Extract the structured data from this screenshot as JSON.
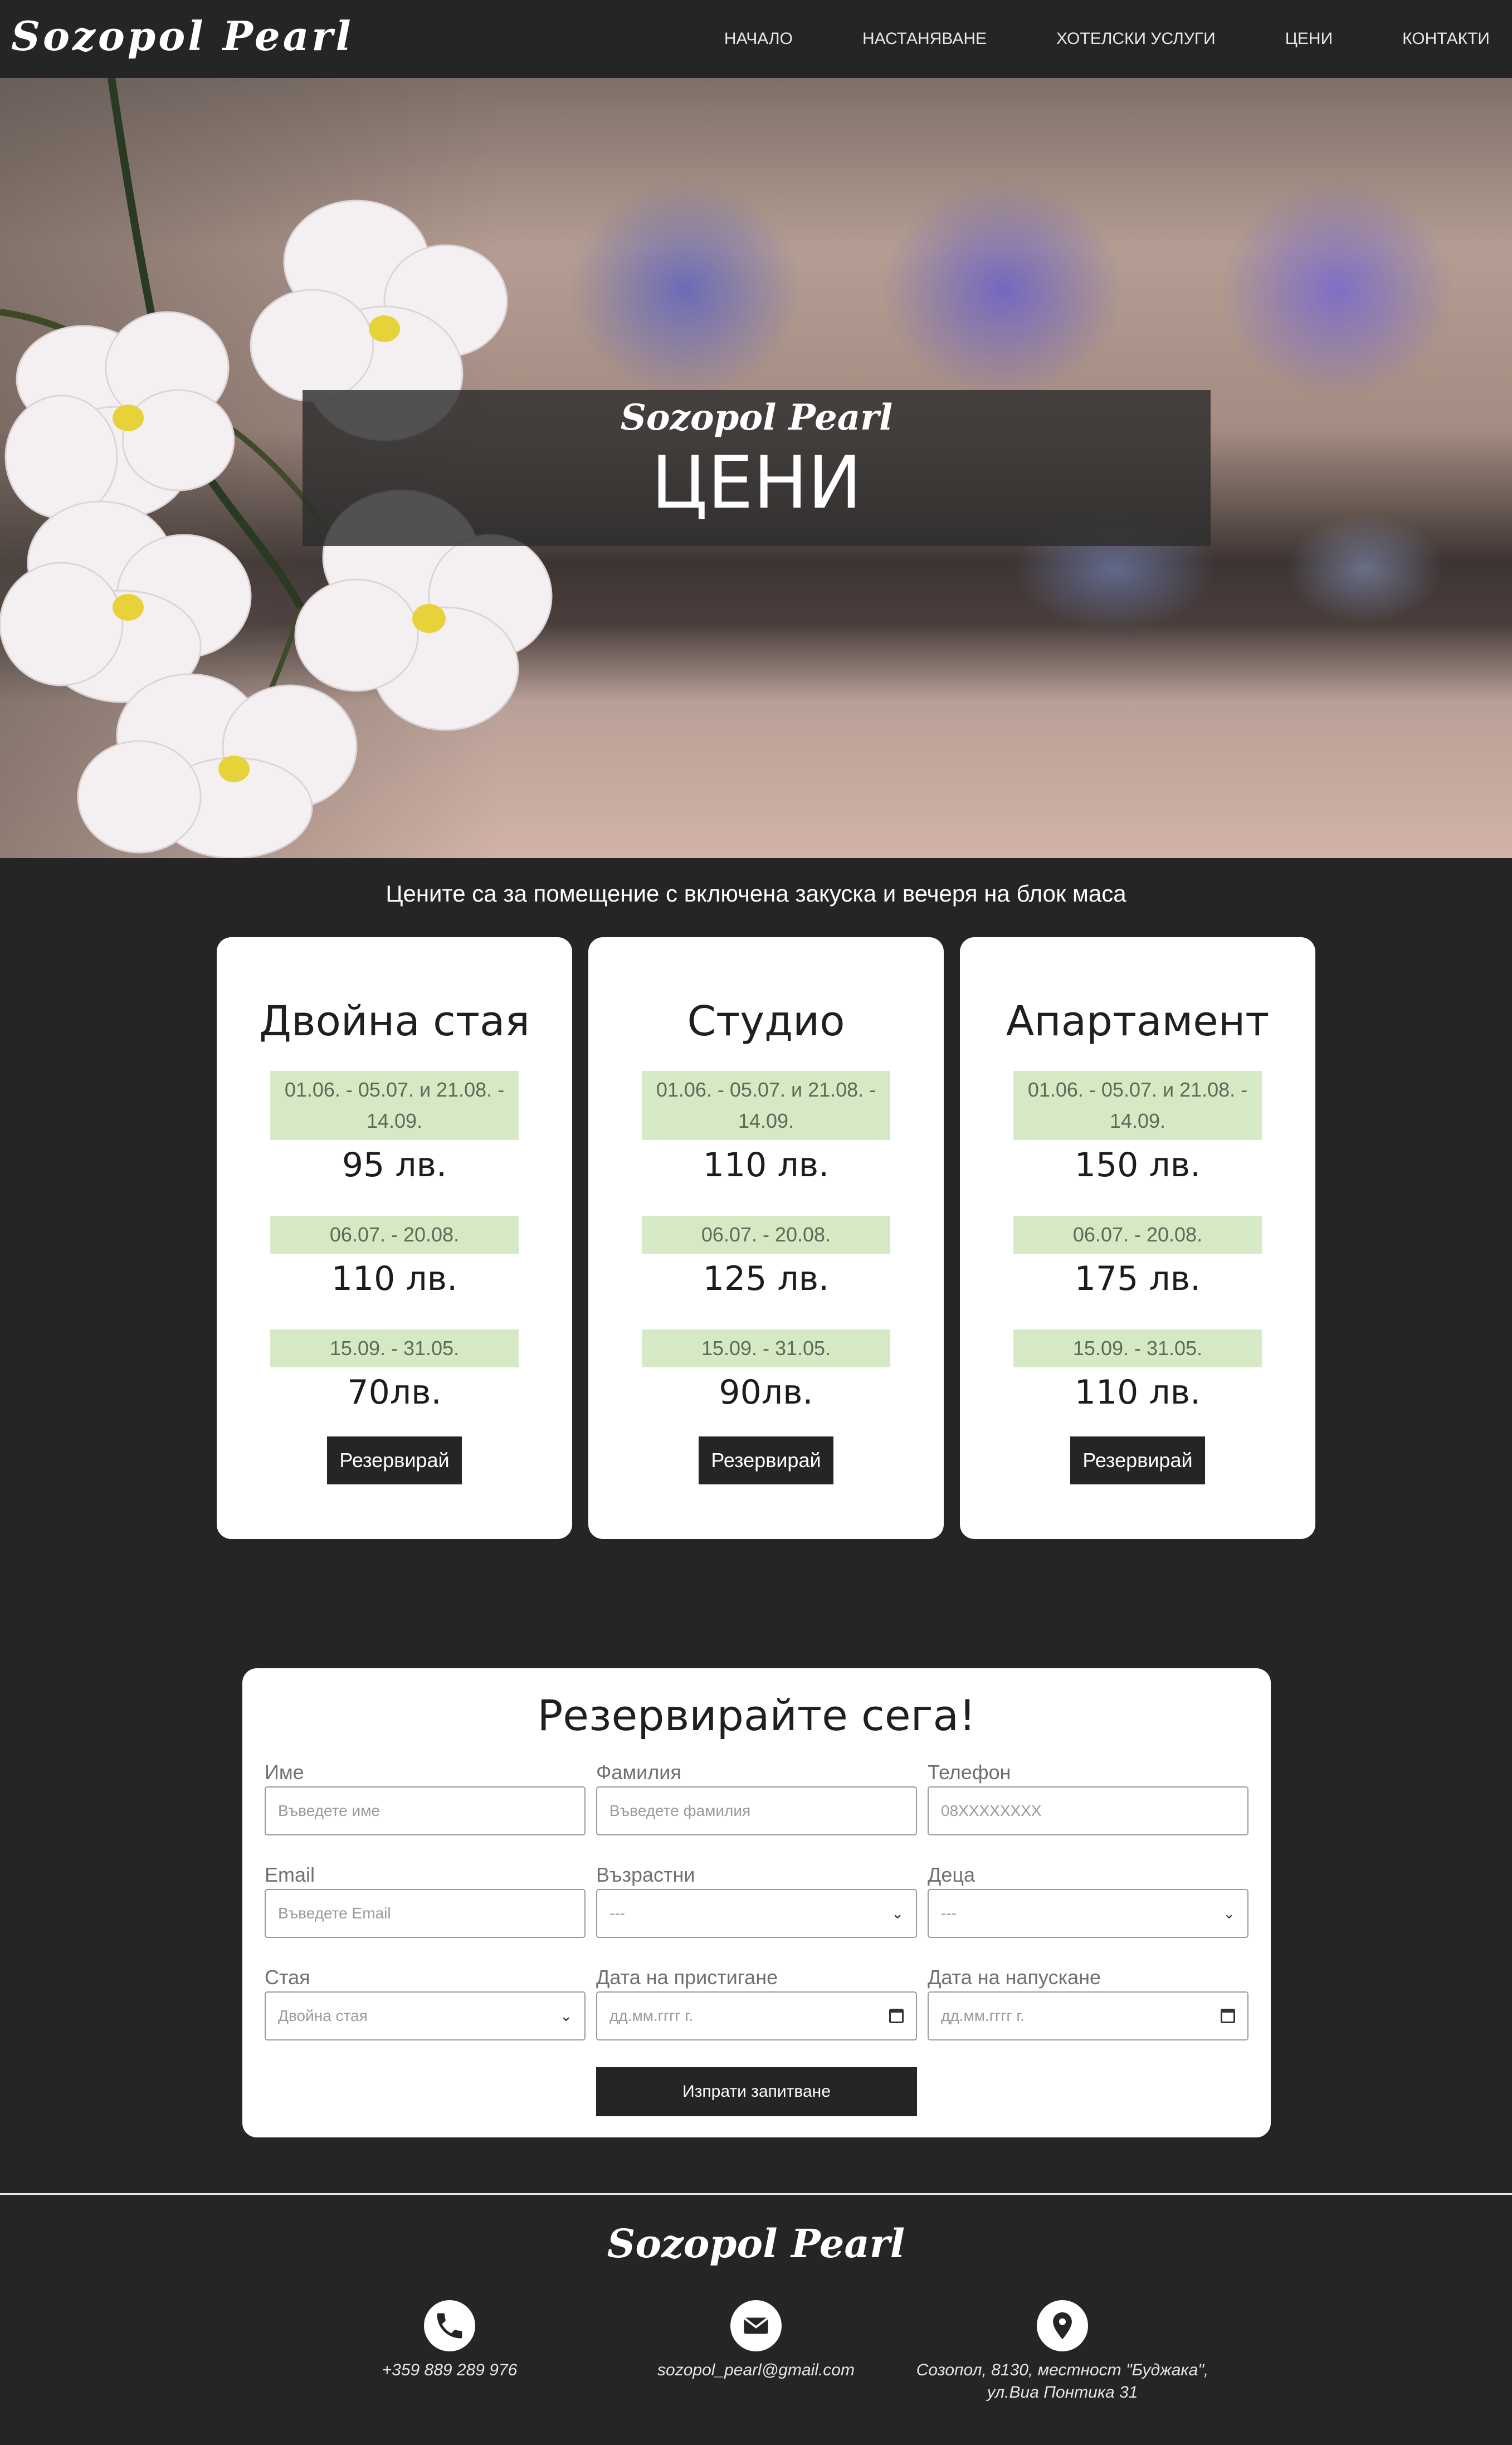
{
  "brand": "Sozopol Pearl",
  "nav": {
    "items": [
      {
        "label": "НАЧАЛО"
      },
      {
        "label": "НАСТАНЯВАНЕ"
      },
      {
        "label": "ХОТЕЛСКИ УСЛУГИ"
      },
      {
        "label": "ЦЕНИ"
      },
      {
        "label": "КОНТАКТИ"
      }
    ]
  },
  "hero": {
    "brand": "Sozopol Pearl",
    "title": "ЦЕНИ"
  },
  "prices": {
    "note": "Цените са за помещение с включена закуска и вечеря на блок маса",
    "cards": [
      {
        "title": "Двойна стая",
        "rates": [
          {
            "period": "01.06. - 05.07. и 21.08. - 14.09.",
            "price": "95 лв."
          },
          {
            "period": "06.07. - 20.08.",
            "price": "110 лв."
          },
          {
            "period": "15.09. - 31.05.",
            "price": "70лв."
          }
        ],
        "button": "Резервирай"
      },
      {
        "title": "Студио",
        "rates": [
          {
            "period": "01.06. - 05.07. и 21.08. - 14.09.",
            "price": "110 лв."
          },
          {
            "period": "06.07. - 20.08.",
            "price": "125 лв."
          },
          {
            "period": "15.09. - 31.05.",
            "price": "90лв."
          }
        ],
        "button": "Резервирай"
      },
      {
        "title": "Апартамент",
        "rates": [
          {
            "period": "01.06. - 05.07. и 21.08. - 14.09.",
            "price": "150 лв."
          },
          {
            "period": "06.07. - 20.08.",
            "price": "175 лв."
          },
          {
            "period": "15.09. - 31.05.",
            "price": "110 лв."
          }
        ],
        "button": "Резервирай"
      }
    ]
  },
  "form": {
    "title": "Резервирайте сега!",
    "first_name": {
      "label": "Име",
      "placeholder": "Въведете име"
    },
    "last_name": {
      "label": "Фамилия",
      "placeholder": "Въведете фамилия"
    },
    "phone": {
      "label": "Телефон",
      "placeholder": "08XXXXXXXX"
    },
    "email": {
      "label": "Email",
      "placeholder": "Въведете Email"
    },
    "adults": {
      "label": "Възрастни",
      "value": "---"
    },
    "children": {
      "label": "Деца",
      "value": "---"
    },
    "room": {
      "label": "Стая",
      "value": "Двойна стая"
    },
    "arrival": {
      "label": "Дата на пристигане",
      "placeholder": "дд.мм.гггг г."
    },
    "departure": {
      "label": "Дата на напускане",
      "placeholder": "дд.мм.гггг г."
    },
    "submit": "Изпрати запитване"
  },
  "footer": {
    "brand": "Sozopol Pearl",
    "phone": "+359 889 289 976",
    "email": "sozopol_pearl@gmail.com",
    "address_line1": "Созопол, 8130, местност \"Буджака\",",
    "address_line2": "ул.Виа Понтика 31"
  }
}
